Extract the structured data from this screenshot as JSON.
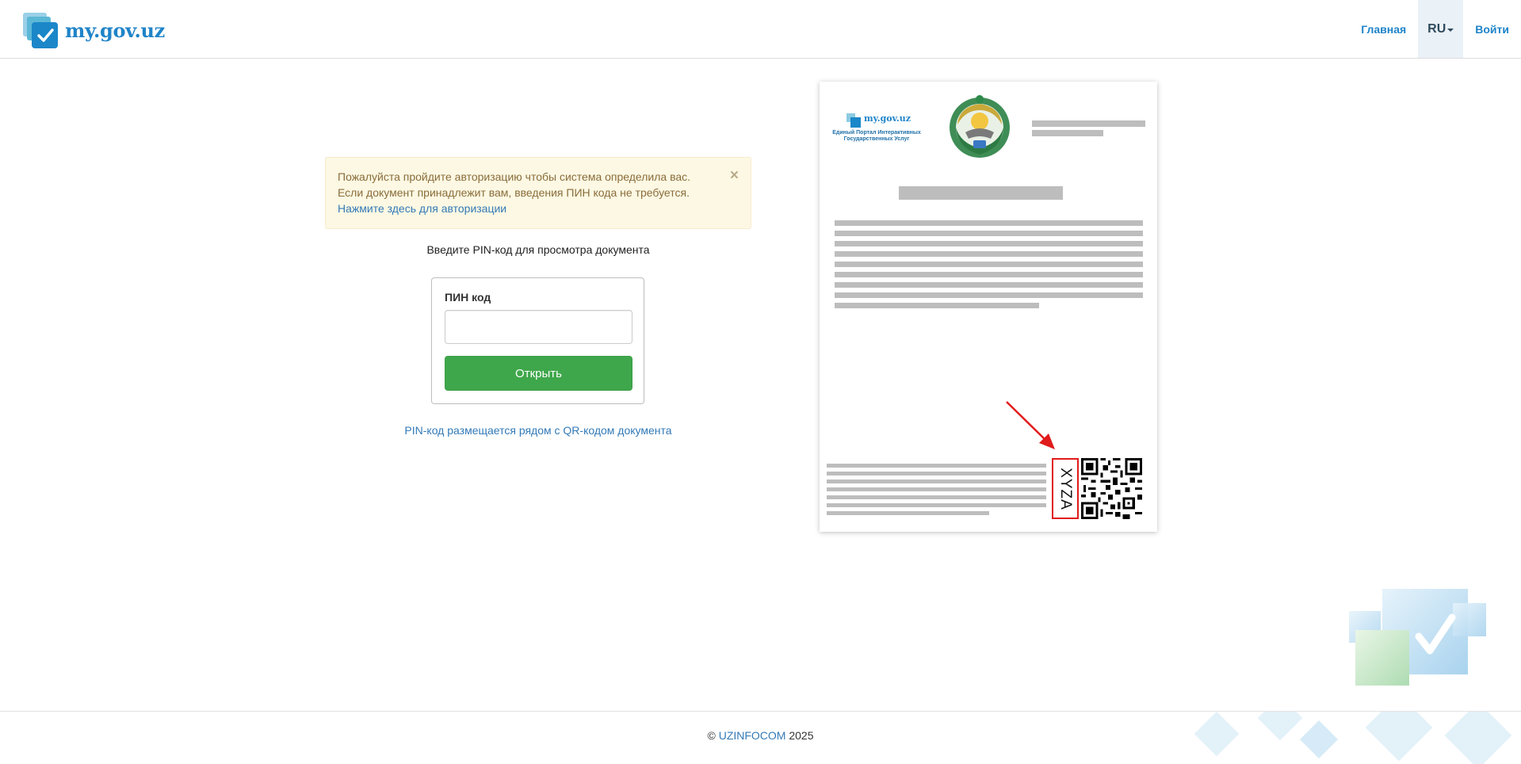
{
  "header": {
    "logo_text": "my.gov.uz",
    "nav": {
      "home": "Главная",
      "lang": "RU",
      "login": "Войти"
    }
  },
  "alert": {
    "text": "Пожалуйста пройдите авторизацию чтобы система определила вас. Если документ принадлежит вам, введения ПИН кода не требуется.",
    "link": "Нажмите здесь для авторизации",
    "close": "×"
  },
  "pin": {
    "title": "Введите PIN-код для просмотра документа",
    "label": "ПИН код",
    "value": "",
    "button": "Открыть",
    "hint": "PIN-код размещается рядом с QR-кодом документа"
  },
  "sample_doc": {
    "logo_name": "my.gov.uz",
    "logo_sub1": "Единый Портал Интерактивных",
    "logo_sub2": "Государственных Услуг",
    "pin_sample": "XYZA"
  },
  "footer": {
    "copyright": "©",
    "company": "UZINFOCOM",
    "year": "2025"
  },
  "colors": {
    "link": "#337ab7",
    "brand": "#1f84c8",
    "button": "#3fa74b",
    "alert_bg": "#fcf8e3",
    "alert_text": "#8a6d3b",
    "highlight": "#e01b1b"
  },
  "icons": [
    "logo-icon",
    "caret-down-icon",
    "close-icon",
    "emblem-icon",
    "qr-code-icon",
    "arrow-icon"
  ]
}
